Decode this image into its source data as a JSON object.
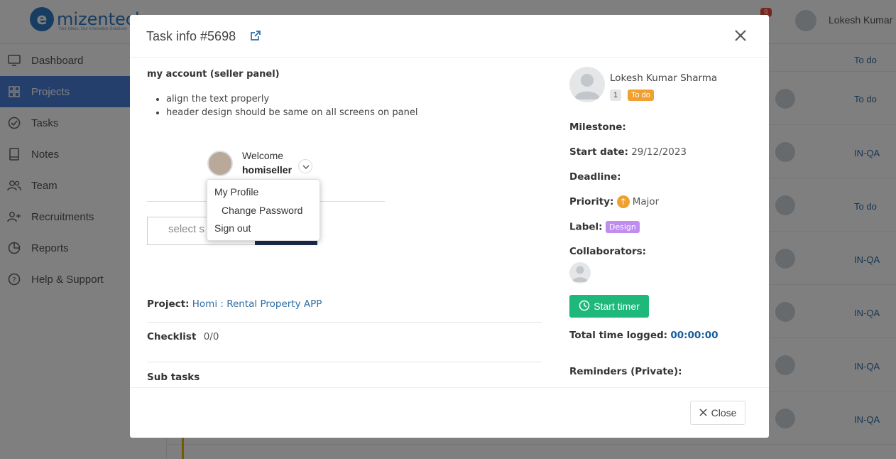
{
  "app": {
    "logo_text": "mizentech",
    "logo_tagline": "Your Ideas, Our Innovative Solutions",
    "notification_count": "9",
    "user_name": "Lokesh Kumar"
  },
  "sidebar": {
    "items": [
      {
        "label": "Dashboard",
        "icon": "monitor-icon",
        "active": false
      },
      {
        "label": "Projects",
        "icon": "grid-icon",
        "active": true
      },
      {
        "label": "Tasks",
        "icon": "check-circle-icon",
        "active": false
      },
      {
        "label": "Notes",
        "icon": "book-icon",
        "active": false
      },
      {
        "label": "Team",
        "icon": "users-icon",
        "active": false
      },
      {
        "label": "Recruitments",
        "icon": "user-plus-icon",
        "active": false
      },
      {
        "label": "Reports",
        "icon": "pie-chart-icon",
        "active": false
      },
      {
        "label": "Help & Support",
        "icon": "help-circle-icon",
        "active": false
      }
    ]
  },
  "background_list": {
    "statuses": [
      "To do",
      "To do",
      "IN-QA",
      "To do",
      "IN-QA",
      "IN-QA",
      "IN-QA",
      "IN-QA"
    ]
  },
  "modal": {
    "title": "Task info #5698",
    "description": {
      "title": "my account (seller panel)",
      "bullets": [
        "align the text properly",
        "header design should be same on all screens on panel"
      ]
    },
    "screenshot": {
      "welcome": "Welcome",
      "username": "homiseller",
      "select_placeholder": "select s",
      "dropdown": [
        "My Profile",
        "Change Password",
        "Sign out"
      ]
    },
    "project_label": "Project:",
    "project_value": "Homi : Rental Property APP",
    "checklist_label": "Checklist",
    "checklist_value": "0/0",
    "subtasks_label": "Sub tasks",
    "assignee": {
      "name": "Lokesh Kumar Sharma",
      "badge_number": "1",
      "status": "To do"
    },
    "milestone_label": "Milestone:",
    "start_date_label": "Start date:",
    "start_date_value": "29/12/2023",
    "deadline_label": "Deadline:",
    "priority_label": "Priority:",
    "priority_value": "Major",
    "label_label": "Label:",
    "label_value": "Design",
    "collaborators_label": "Collaborators:",
    "start_timer": "Start timer",
    "total_time_label": "Total time logged:",
    "total_time_value": "00:00:00",
    "reminders_label": "Reminders (Private):",
    "close_button": "Close"
  },
  "colors": {
    "primary_active": "#4a7fd9",
    "timer_green": "#1db87a",
    "status_orange": "#f0a030",
    "label_purple": "#c08cf0",
    "link_blue": "#2e6da4"
  }
}
